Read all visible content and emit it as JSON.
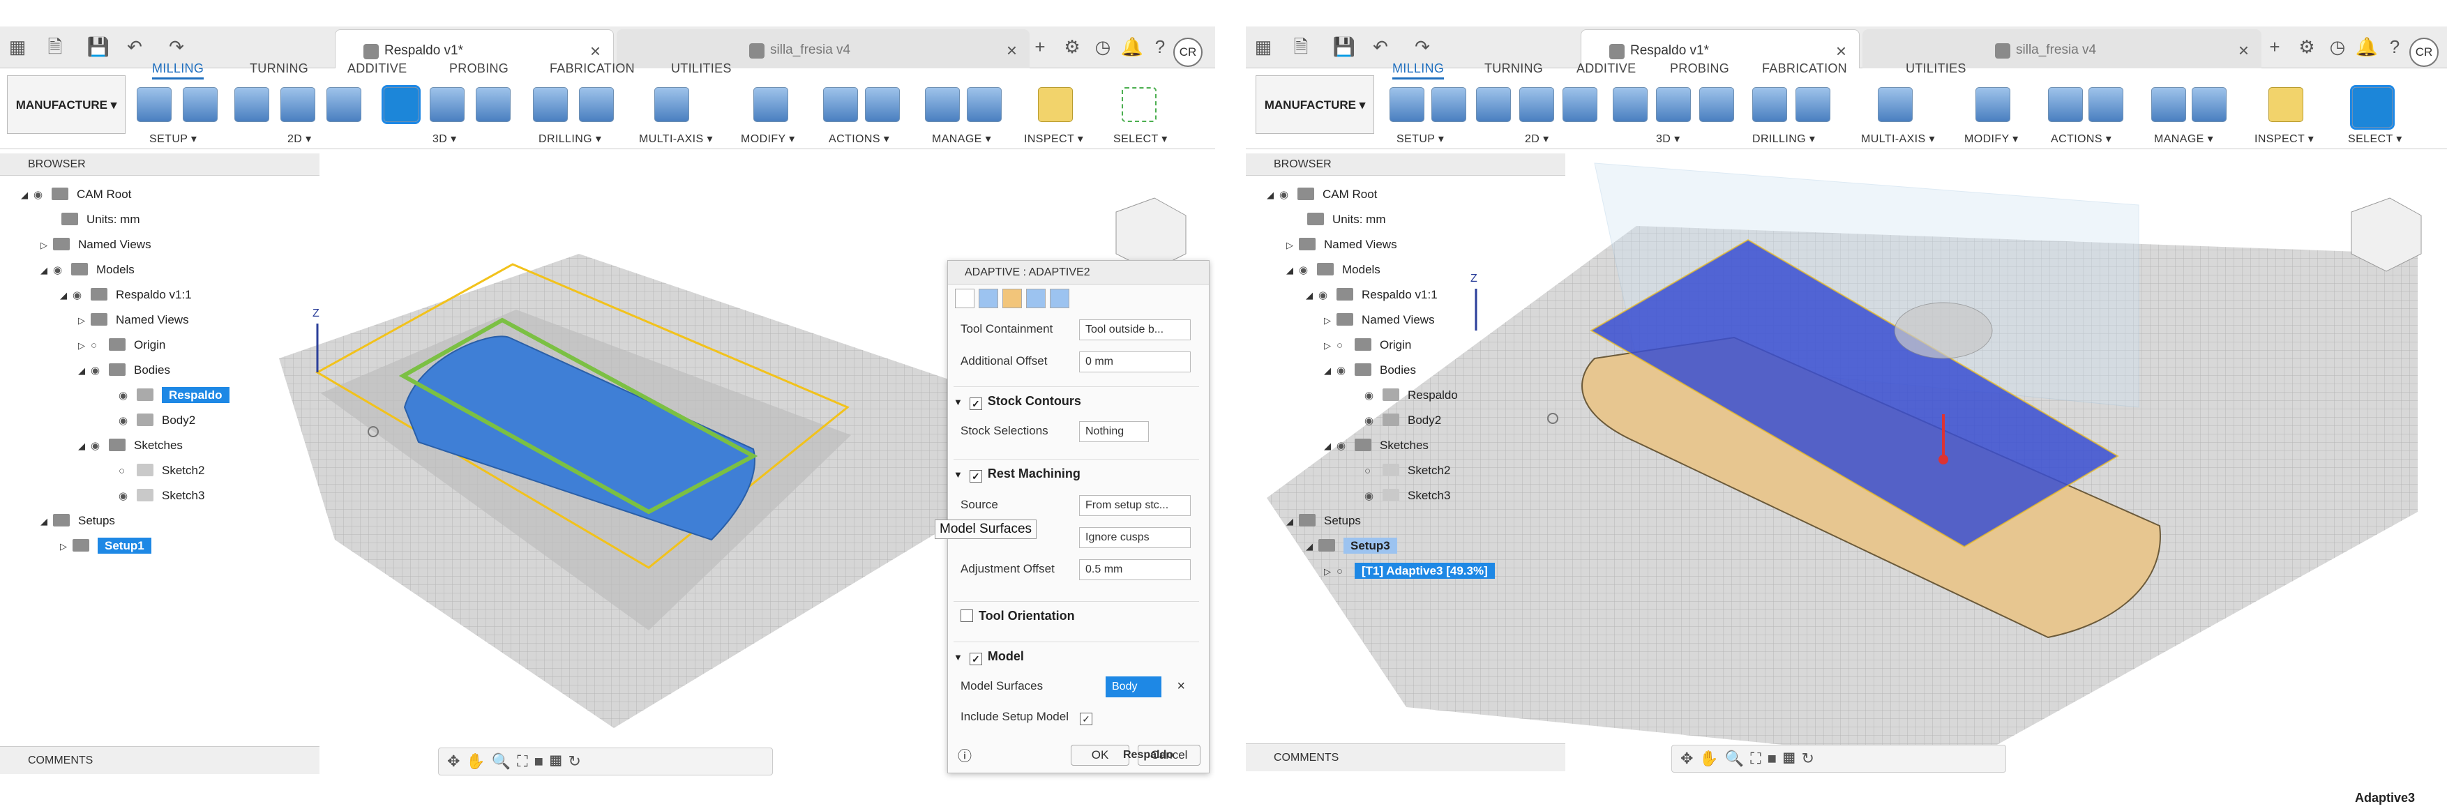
{
  "left": {
    "tabs": {
      "active": "Respaldo v1*",
      "inactive": "silla_fresia v4"
    },
    "avatar": "CR",
    "ribbon_tabs": [
      "MILLING",
      "TURNING",
      "ADDITIVE",
      "PROBING",
      "FABRICATION",
      "UTILITIES"
    ],
    "workspace": "MANUFACTURE ▾",
    "groups": {
      "setup": "SETUP ▾",
      "d2": "2D ▾",
      "d3": "3D ▾",
      "drilling": "DRILLING ▾",
      "multiaxis": "MULTI-AXIS ▾",
      "modify": "MODIFY ▾",
      "actions": "ACTIONS ▾",
      "manage": "MANAGE ▾",
      "inspect": "INSPECT ▾",
      "select": "SELECT ▾"
    },
    "browser_title": "BROWSER",
    "tree": [
      "CAM Root",
      "Units: mm",
      "Named Views",
      "Models",
      "Respaldo v1:1",
      "Named Views",
      "Origin",
      "Bodies",
      "Respaldo",
      "Body2",
      "Sketches",
      "Sketch2",
      "Sketch3",
      "Setups",
      "Setup1"
    ],
    "comments": "COMMENTS",
    "dialog": {
      "title": "ADAPTIVE : ADAPTIVE2",
      "tool_containment_label": "Tool Containment",
      "tool_containment_value": "Tool outside b...",
      "additional_offset_label": "Additional Offset",
      "additional_offset_value": "0 mm",
      "stock_contours": "Stock Contours",
      "stock_selections_label": "Stock Selections",
      "stock_selections_value": "Nothing",
      "rest_machining": "Rest Machining",
      "source_label": "Source",
      "source_value": "From setup stc...",
      "tooltip": "Model Surfaces",
      "adjustment_value": "Ignore cusps",
      "adjustment_offset_label": "Adjustment Offset",
      "adjustment_offset_value": "0.5 mm",
      "tool_orientation": "Tool Orientation",
      "model": "Model",
      "model_surfaces_label": "Model Surfaces",
      "model_surfaces_value": "Body",
      "include_setup_model": "Include Setup Model",
      "ok": "OK",
      "cancel": "Cancel",
      "status_overlay": "Respaldo"
    }
  },
  "right": {
    "tabs": {
      "active": "Respaldo v1*",
      "inactive": "silla_fresia v4"
    },
    "avatar": "CR",
    "ribbon_tabs": [
      "MILLING",
      "TURNING",
      "ADDITIVE",
      "PROBING",
      "FABRICATION",
      "UTILITIES"
    ],
    "workspace": "MANUFACTURE ▾",
    "groups": {
      "setup": "SETUP ▾",
      "d2": "2D ▾",
      "d3": "3D ▾",
      "drilling": "DRILLING ▾",
      "multiaxis": "MULTI-AXIS ▾",
      "modify": "MODIFY ▾",
      "actions": "ACTIONS ▾",
      "manage": "MANAGE ▾",
      "inspect": "INSPECT ▾",
      "select": "SELECT ▾"
    },
    "browser_title": "BROWSER",
    "tree": [
      "CAM Root",
      "Units: mm",
      "Named Views",
      "Models",
      "Respaldo v1:1",
      "Named Views",
      "Origin",
      "Bodies",
      "Respaldo",
      "Body2",
      "Sketches",
      "Sketch2",
      "Sketch3",
      "Setups",
      "Setup3",
      "[T1] Adaptive3 [49.3%]"
    ],
    "comments": "COMMENTS",
    "status_name": "Adaptive3"
  },
  "colors": {
    "accent": "#1e88e5",
    "toolpath": "#3a4fd1",
    "stock": "#e7c690",
    "setup_box": "#f2c21b",
    "sketch": "#78c043"
  }
}
